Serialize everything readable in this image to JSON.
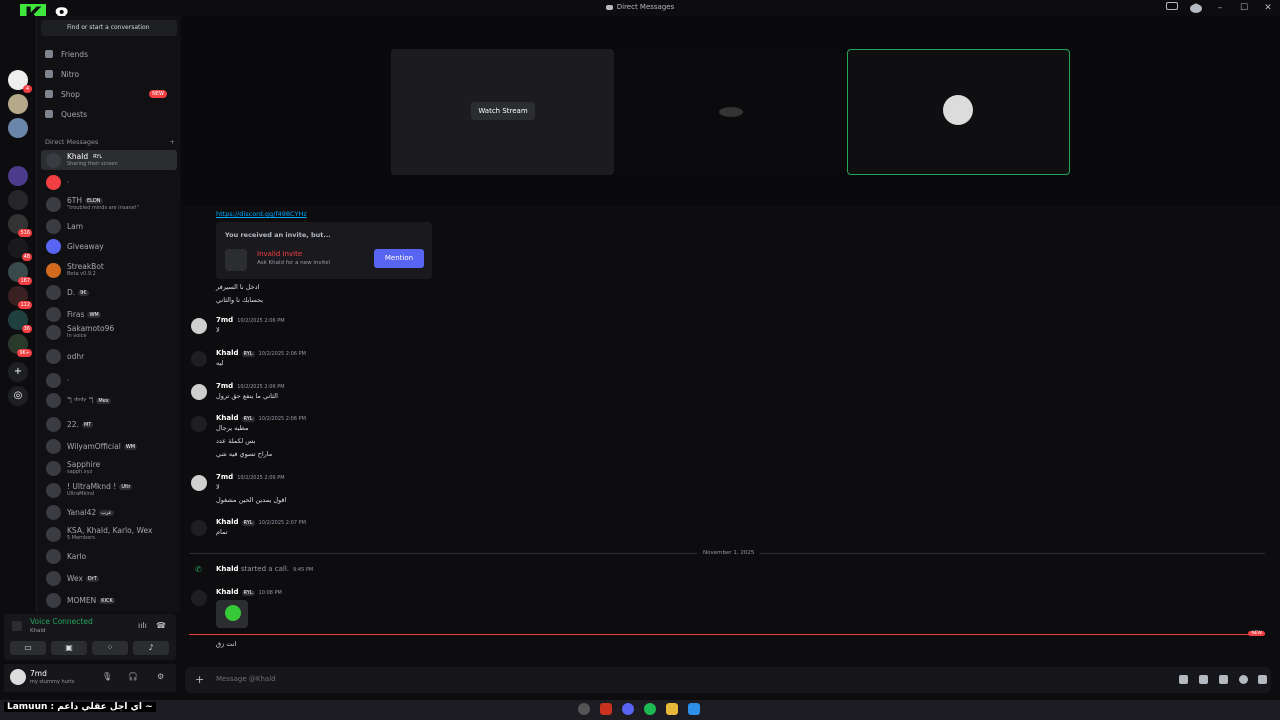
{
  "window": {
    "title": "Direct Messages"
  },
  "logo": {
    "letter": "K",
    "number": "8"
  },
  "rail_badges": [
    "4",
    "516",
    "48",
    "167",
    "112",
    "36",
    "9K+"
  ],
  "sidebar": {
    "search_placeholder": "Find or start a conversation",
    "nav": [
      {
        "label": "Friends",
        "icon": "friends-icon"
      },
      {
        "label": "Nitro",
        "icon": "nitro-icon"
      },
      {
        "label": "Shop",
        "icon": "shop-icon",
        "badge": "NEW"
      },
      {
        "label": "Quests",
        "icon": "quests-icon"
      }
    ],
    "dm_header": "Direct Messages",
    "dm_add": "+",
    "dms": [
      {
        "name": "Khald",
        "tag": "RYL",
        "sub": "Sharing their screen"
      },
      {
        "name": "·",
        "tag": "",
        "sub": ""
      },
      {
        "name": "6TH",
        "tag": "ELDN",
        "sub": "\"troubled minds are insane!\""
      },
      {
        "name": "Lam",
        "tag": "",
        "sub": ""
      },
      {
        "name": "Giveaway",
        "tag": "",
        "sub": ""
      },
      {
        "name": "StreakBot",
        "tag": "",
        "sub": "Beta v0.9.2"
      },
      {
        "name": "D.",
        "tag": "9€",
        "sub": ""
      },
      {
        "name": "Firas",
        "tag": "WM",
        "sub": ""
      },
      {
        "name": "Sakamoto96",
        "tag": "",
        "sub": "In voice"
      },
      {
        "name": "odhr",
        "tag": "",
        "sub": ""
      },
      {
        "name": "·",
        "tag": "",
        "sub": ""
      },
      {
        "name": "ℸ ᵈᵒᵈʸ ℸ",
        "tag": "Mex",
        "sub": ""
      },
      {
        "name": "22.",
        "tag": "MT",
        "sub": ""
      },
      {
        "name": "WilyamOfficial",
        "tag": "WM",
        "sub": ""
      },
      {
        "name": "Sapphire",
        "tag": "",
        "sub": "sapph.xyz"
      },
      {
        "name": "! UltraMknd !",
        "tag": "Ultr",
        "sub": "UltraMkind"
      },
      {
        "name": "Yanal42",
        "tag": "عرب",
        "sub": ""
      },
      {
        "name": "KSA, Khald, Karlo, Wex",
        "tag": "",
        "sub": "5 Members"
      },
      {
        "name": "Karlo",
        "tag": "",
        "sub": ""
      },
      {
        "name": "Wex",
        "tag": "DrT",
        "sub": ""
      },
      {
        "name": "MOMEN",
        "tag": "KICK",
        "sub": ""
      }
    ]
  },
  "voice": {
    "status": "Voice Connected",
    "channel": "Khald"
  },
  "user": {
    "name": "7md",
    "status": "my stummy hurts"
  },
  "stage": {
    "watch_label": "Watch Stream",
    "tile2_label": "··"
  },
  "chat": {
    "link": "https://discord.gg/f498CYHz",
    "invite": {
      "header": "You received an invite, but...",
      "title": "Invalid Invite",
      "subtitle": "Ask Khald for a new invite!",
      "button": "Mention"
    },
    "pre_lines": [
      "ادخل نا السيرفر",
      "بحسابك نا والثاني"
    ],
    "messages": [
      {
        "author": "7md",
        "tag": "",
        "time": "10/2/2025 2:06 PM",
        "lines": [
          "لا"
        ]
      },
      {
        "author": "Khald",
        "tag": "RYL",
        "time": "10/2/2025 2:06 PM",
        "lines": [
          "ليه"
        ]
      },
      {
        "author": "7md",
        "tag": "",
        "time": "10/2/2025 2:06 PM",
        "lines": [
          "الثاني ما ينفع حق ترول"
        ]
      },
      {
        "author": "Khald",
        "tag": "RYL",
        "time": "10/2/2025 2:06 PM",
        "lines": [
          "مطيه يرجال",
          "بس لكملة عدد",
          "ماراح تسوي فيه شي"
        ]
      },
      {
        "author": "7md",
        "tag": "",
        "time": "10/2/2025 2:06 PM",
        "lines": [
          "لا",
          "اقول يمدين الحين مشغول"
        ]
      },
      {
        "author": "Khald",
        "tag": "RYL",
        "time": "10/2/2025 2:07 PM",
        "lines": [
          "تمام"
        ]
      }
    ],
    "date_divider": "November 1, 2025",
    "call": {
      "author": "Khald",
      "text": "started a call.",
      "time": "9:45 PM"
    },
    "last_msg": {
      "author": "Khald",
      "tag": "RYL",
      "time": "10:08 PM"
    },
    "new_label": "NEW",
    "after_new": "انت زق",
    "composer_placeholder": "Message @Khald"
  },
  "taskbar": {
    "caption": "Lamuun : اي اجل عقلي داعم ~"
  },
  "colors": {
    "accent": "#5865f2",
    "online": "#23a55a",
    "danger": "#f23f43",
    "link": "#00a8fc"
  }
}
